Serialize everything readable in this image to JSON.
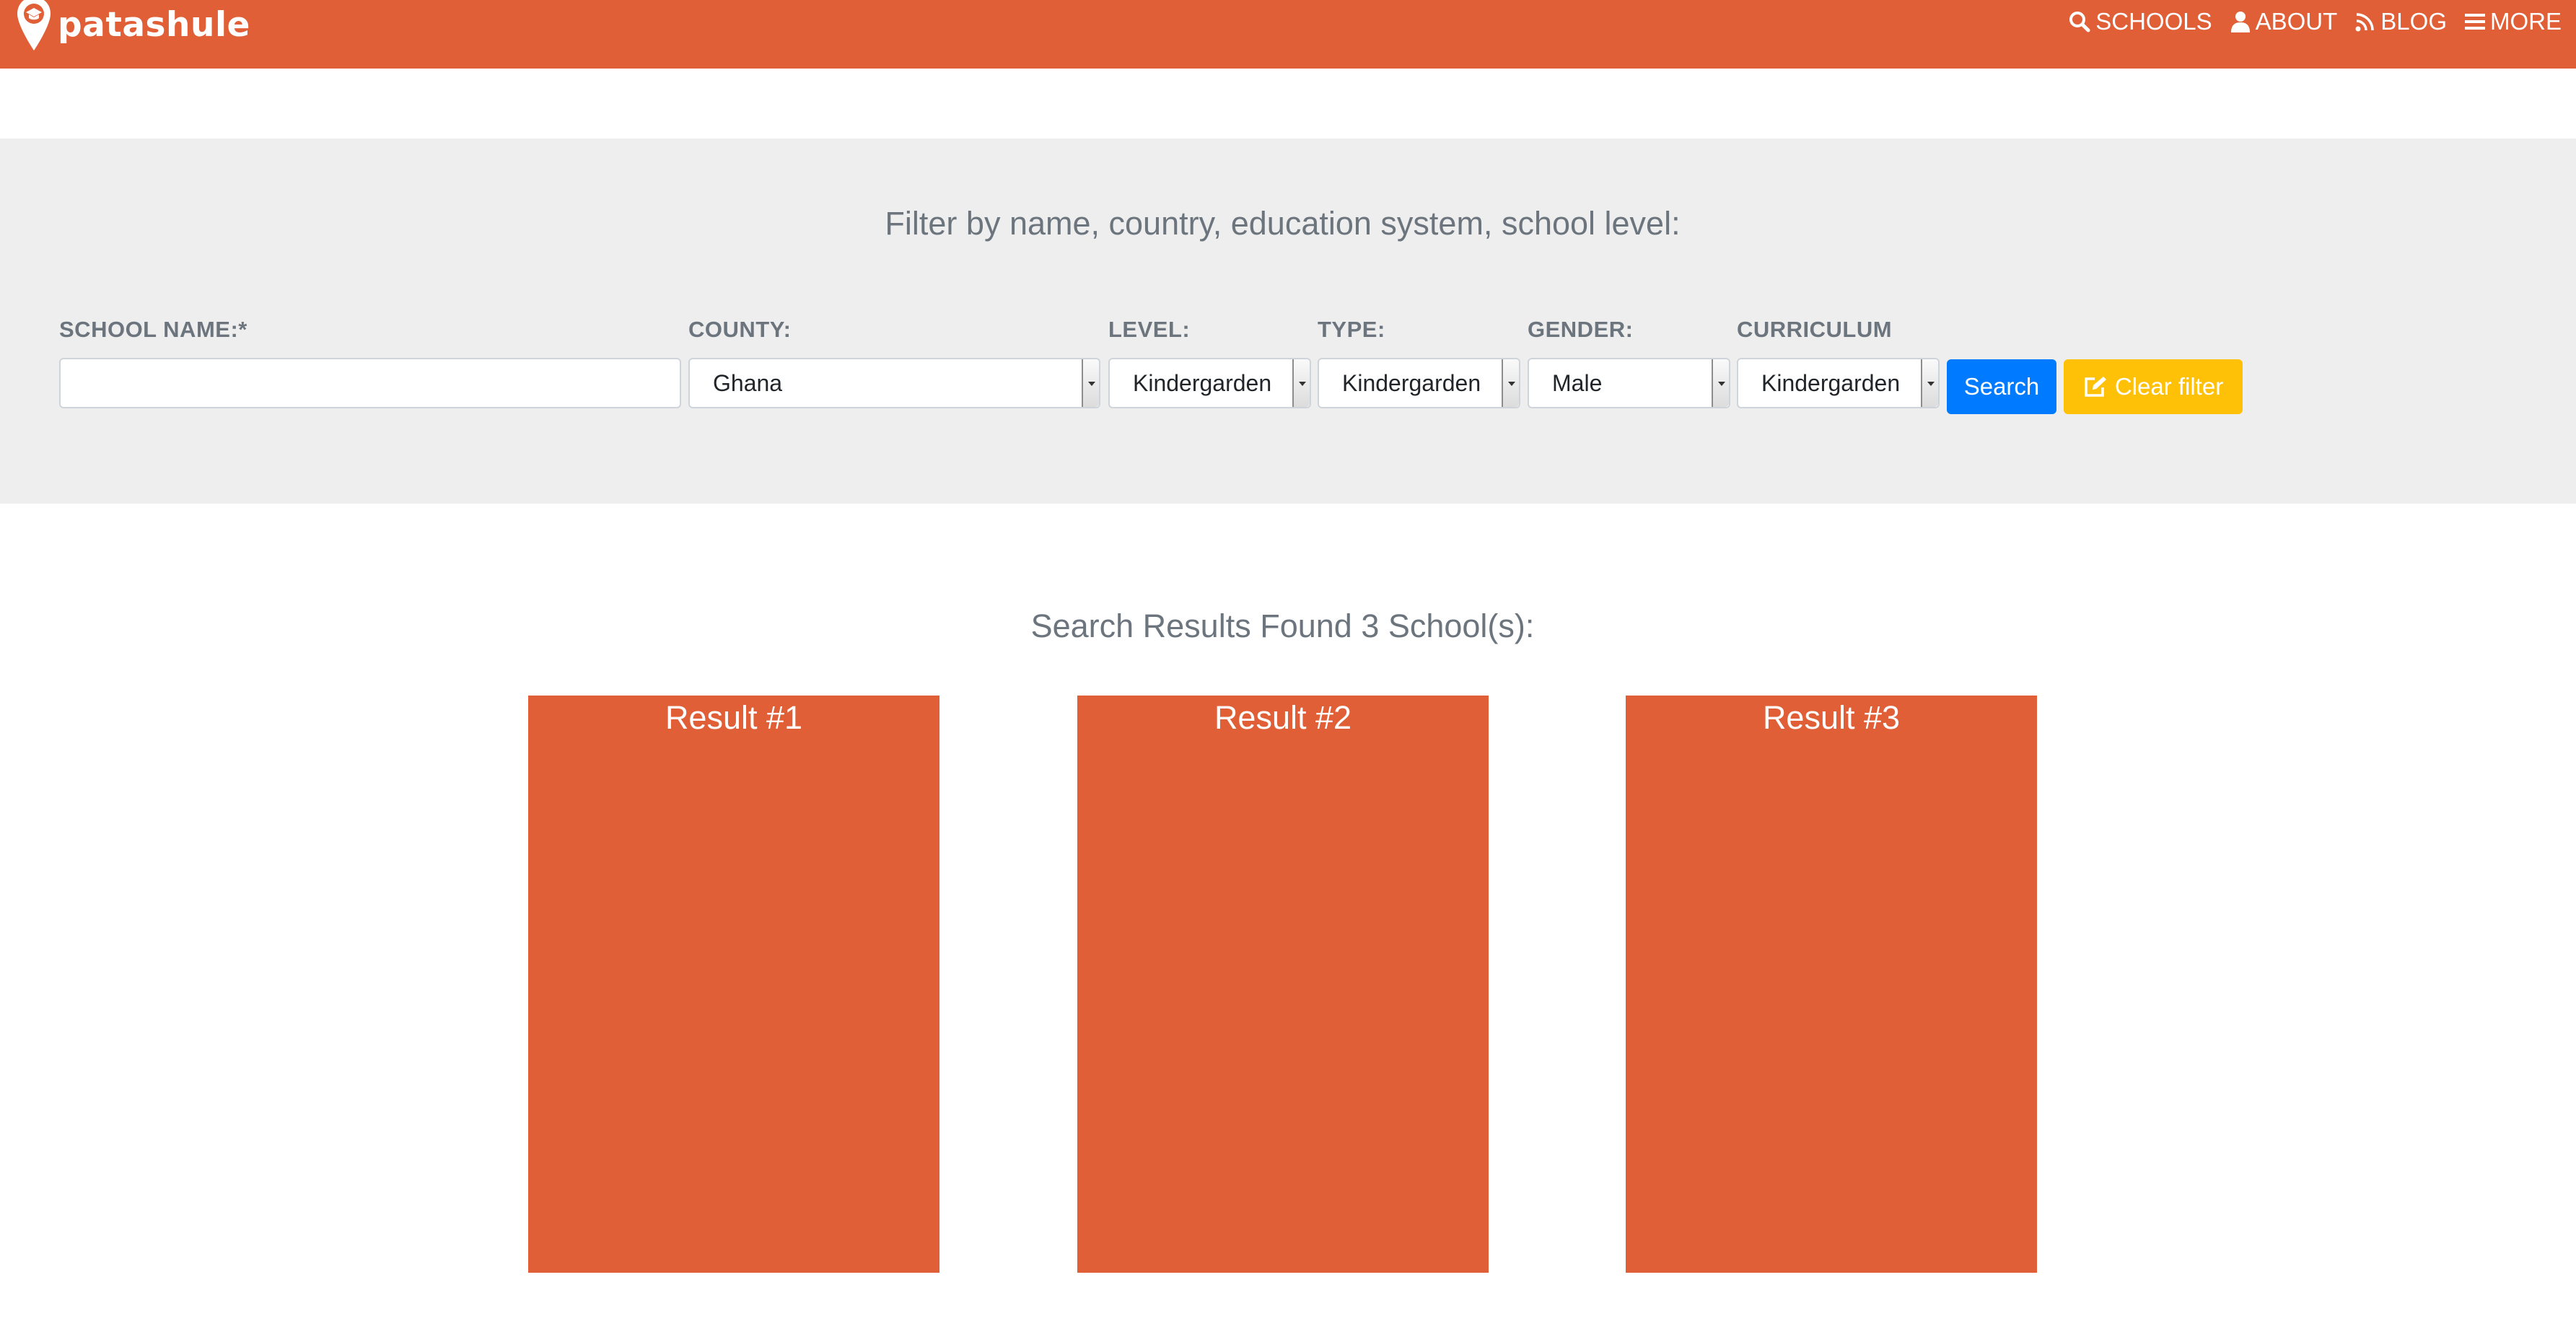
{
  "brand": {
    "name": "patashule"
  },
  "nav": {
    "items": [
      {
        "label": "SCHOOLS",
        "icon": "search-icon"
      },
      {
        "label": "ABOUT",
        "icon": "user-icon"
      },
      {
        "label": "BLOG",
        "icon": "rss-icon"
      },
      {
        "label": "MORE",
        "icon": "bars-icon"
      }
    ]
  },
  "filter": {
    "title": "Filter by name, country, education system, school level:",
    "school_name": {
      "label": "SCHOOL NAME:*",
      "value": "",
      "placeholder": ""
    },
    "county": {
      "label": "COUNTY:",
      "value": "Ghana"
    },
    "level": {
      "label": "LEVEL:",
      "value": "Kindergarden"
    },
    "type": {
      "label": "TYPE:",
      "value": "Kindergarden"
    },
    "gender": {
      "label": "GENDER:",
      "value": "Male"
    },
    "curriculum": {
      "label": "CURRICULUM",
      "value": "Kindergarden"
    },
    "search_button": "Search",
    "clear_button": "Clear filter"
  },
  "results": {
    "title": "Search Results Found 3 School(s):",
    "cards": [
      {
        "title": "Result #1"
      },
      {
        "title": "Result #2"
      },
      {
        "title": "Result #3"
      }
    ]
  },
  "colors": {
    "brand": "#e05f37",
    "filter_bg": "#eeeeee",
    "primary": "#007bff",
    "warning": "#ffc107",
    "muted_text": "#6c757d"
  }
}
